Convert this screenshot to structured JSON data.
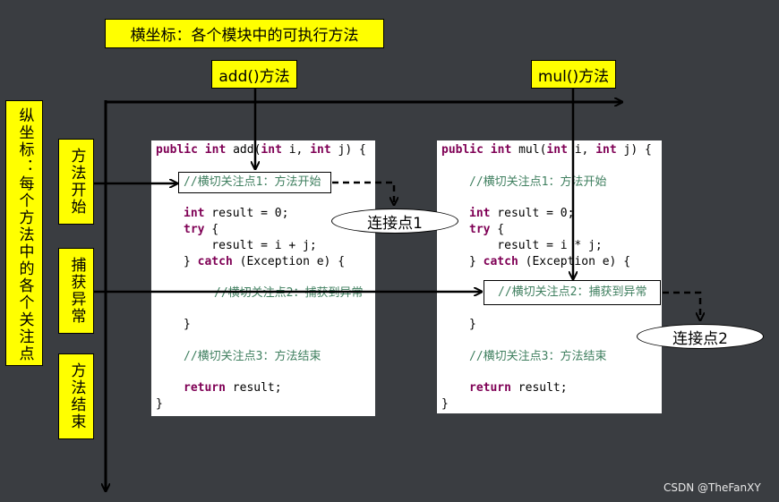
{
  "title": "横坐标：各个模块中的可执行方法",
  "methods": {
    "add_label": "add()方法",
    "mul_label": "mul()方法"
  },
  "y_axis_label": "纵坐标：每个方法中的各个关注点",
  "phases": {
    "start": "方法开始",
    "catch": "捕获异常",
    "end": "方法结束"
  },
  "add_code": {
    "sig_kw1": "public",
    "sig_kw2": "int",
    "sig_name": " add(",
    "sig_kw3": "int",
    "sig_p1": " i, ",
    "sig_kw4": "int",
    "sig_p2": " j) {",
    "c1": "//横切关注点1：方法开始",
    "decl_kw": "int",
    "decl": " result = 0;",
    "try_kw": "try",
    "try_rest": " {",
    "assign": "    result = i + j;",
    "close_catch": "} ",
    "catch_kw": "catch",
    "catch_rest": " (Exception e) {",
    "c2": "//横切关注点2：捕获到异常",
    "close1": "}",
    "c3": "//横切关注点3：方法结束",
    "ret_kw": "return",
    "ret_rest": " result;",
    "close2": "}"
  },
  "mul_code": {
    "sig_kw1": "public",
    "sig_kw2": "int",
    "sig_name": " mul(",
    "sig_kw3": "int",
    "sig_p1": " i, ",
    "sig_kw4": "int",
    "sig_p2": " j) {",
    "c1": "//横切关注点1：方法开始",
    "decl_kw": "int",
    "decl": " result = 0;",
    "try_kw": "try",
    "try_rest": " {",
    "assign": "    result = i * j;",
    "close_catch": "} ",
    "catch_kw": "catch",
    "catch_rest": " (Exception e) {",
    "c2": "//横切关注点2：捕获到异常",
    "close1": "}",
    "c3": "//横切关注点3：方法结束",
    "ret_kw": "return",
    "ret_rest": " result;",
    "close2": "}"
  },
  "join_points": {
    "one": "连接点1",
    "two": "连接点2"
  },
  "watermark": "CSDN @TheFanXY",
  "colors": {
    "background": "#3a3d41",
    "label_fill": "#ffff00",
    "keyword": "#7f0055",
    "comment": "#3f7f5f"
  }
}
